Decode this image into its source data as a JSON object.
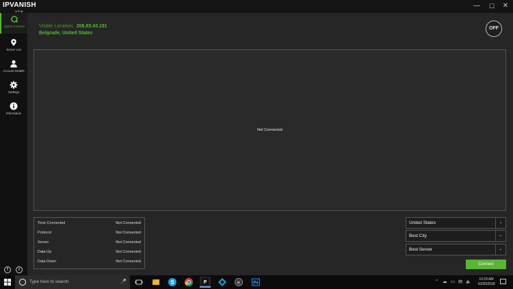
{
  "app": {
    "logo_top": "IPVANISH",
    "logo_bottom": "VPN"
  },
  "window_controls": {
    "minimize": "—",
    "maximize": "☐",
    "close": "✕"
  },
  "sidebar": {
    "items": [
      {
        "label": "Quick Connect",
        "icon": "quick-connect-icon",
        "active": true
      },
      {
        "label": "Server List",
        "icon": "map-pin-icon"
      },
      {
        "label": "Account Details",
        "icon": "user-icon"
      },
      {
        "label": "Settings",
        "icon": "gear-icon"
      },
      {
        "label": "Information",
        "icon": "info-icon"
      }
    ],
    "social": [
      "f",
      "t"
    ]
  },
  "status": {
    "visible_location_label": "Visible Location:",
    "ip": "208.83.43.191",
    "location": "Belgrade, United States",
    "toggle_label": "OFF"
  },
  "graph": {
    "message": "Not Connected"
  },
  "stats": [
    {
      "label": "Time Connected",
      "value": "Not Connected"
    },
    {
      "label": "Protocol",
      "value": "Not Connected"
    },
    {
      "label": "Server",
      "value": "Not Connected"
    },
    {
      "label": "Data Up",
      "value": "Not Connected"
    },
    {
      "label": "Data Down",
      "value": "Not Connected"
    }
  ],
  "selectors": {
    "country": "United States",
    "city": "Best City",
    "server": "Best Server"
  },
  "connect_label": "Connect",
  "taskbar": {
    "search_placeholder": "Type here to search",
    "time": "10:29 AM",
    "date": "10/26/2018"
  },
  "colors": {
    "accent": "#5ab534",
    "background": "#262626",
    "sidebar": "#111111"
  }
}
